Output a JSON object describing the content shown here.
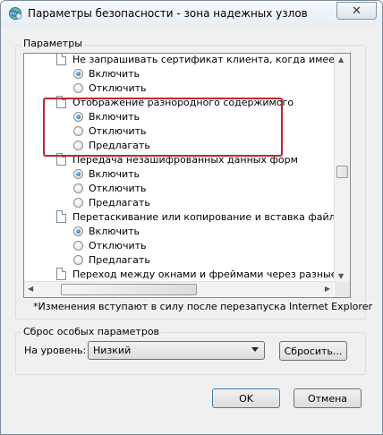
{
  "window": {
    "title": "Параметры безопасности - зона надежных узлов",
    "close_glyph": "✕"
  },
  "settings_group": {
    "label": "Параметры"
  },
  "settings_list": {
    "rows": [
      {
        "kind": "setting",
        "label": "Не запрашивать сертификат клиента, когда имеется тол"
      },
      {
        "kind": "option",
        "label": "Включить",
        "checked": true
      },
      {
        "kind": "option",
        "label": "Отключить",
        "checked": false
      },
      {
        "kind": "setting",
        "label": "Отображение разнородного содержимого"
      },
      {
        "kind": "option",
        "label": "Включить",
        "checked": true
      },
      {
        "kind": "option",
        "label": "Отключить",
        "checked": false
      },
      {
        "kind": "option",
        "label": "Предлагать",
        "checked": false
      },
      {
        "kind": "setting",
        "label": "Передача незашифрованных данных форм"
      },
      {
        "kind": "option",
        "label": "Включить",
        "checked": true
      },
      {
        "kind": "option",
        "label": "Отключить",
        "checked": false
      },
      {
        "kind": "option",
        "label": "Предлагать",
        "checked": false
      },
      {
        "kind": "setting",
        "label": "Перетаскивание или копирование и вставка файлов"
      },
      {
        "kind": "option",
        "label": "Включить",
        "checked": true
      },
      {
        "kind": "option",
        "label": "Отключить",
        "checked": false
      },
      {
        "kind": "option",
        "label": "Предлагать",
        "checked": false
      },
      {
        "kind": "setting",
        "label": "Переход между окнами и фреймами через разные домены"
      }
    ],
    "vertical_scroll_fraction": 0.52,
    "horizontal_scroll_fraction": 0.15
  },
  "restart_note": "*Изменения вступают в силу после перезапуска Internet Explorer",
  "reset_group": {
    "label": "Сброс особых параметров",
    "level_label": "На уровень:",
    "level_value": "Низкий",
    "reset_button": "Сбросить..."
  },
  "dialog_buttons": {
    "ok": "OK",
    "cancel": "Отмена"
  },
  "colors": {
    "highlight": "#c0272d",
    "radio_selected": "#1c77c3"
  }
}
